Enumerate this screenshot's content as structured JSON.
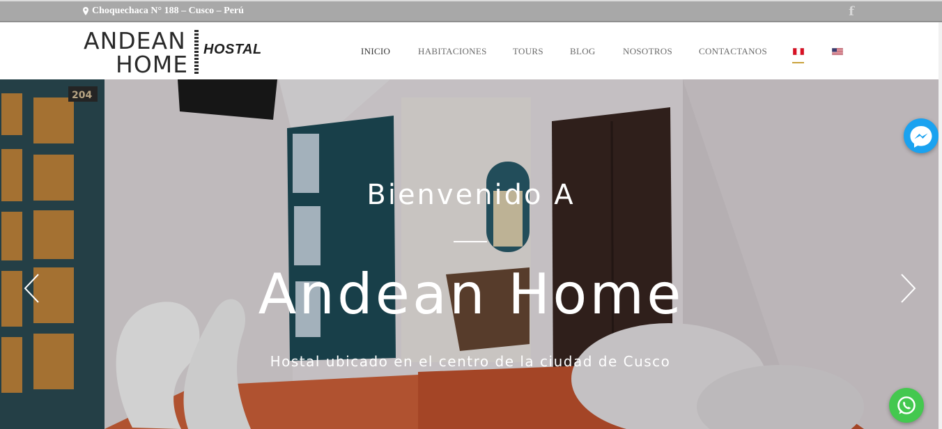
{
  "topbar": {
    "address": "Choquechaca N° 188 – Cusco – Perú",
    "address_icon": "map-marker-icon",
    "facebook_icon": "facebook-icon",
    "facebook_glyph": "f"
  },
  "logo": {
    "line1": "ANDEAN",
    "line2": "HOME",
    "line3": "HOSTAL"
  },
  "nav": {
    "items": [
      {
        "label": "INICIO",
        "active": true
      },
      {
        "label": "HABITACIONES"
      },
      {
        "label": "TOURS"
      },
      {
        "label": "BLOG"
      },
      {
        "label": "NOSOTROS"
      },
      {
        "label": "CONTACTANOS"
      }
    ],
    "languages": [
      {
        "code": "es",
        "icon": "peru-flag-icon",
        "active": true
      },
      {
        "code": "en",
        "icon": "us-flag-icon"
      }
    ]
  },
  "hero": {
    "kicker": "Bienvenido A",
    "title": "Andean Home",
    "subtitle": "Hostal ubicado en el centro de la ciudad de Cusco",
    "room_number": "204",
    "prev_icon": "chevron-left-icon",
    "next_icon": "chevron-right-icon"
  },
  "floating": {
    "messenger_icon": "messenger-icon",
    "whatsapp_icon": "whatsapp-icon"
  },
  "colors": {
    "topbar_bg": "#a8a8a8",
    "active_underline": "#c9a13b",
    "messenger": "#1aa2f0",
    "whatsapp": "#44c84f"
  }
}
